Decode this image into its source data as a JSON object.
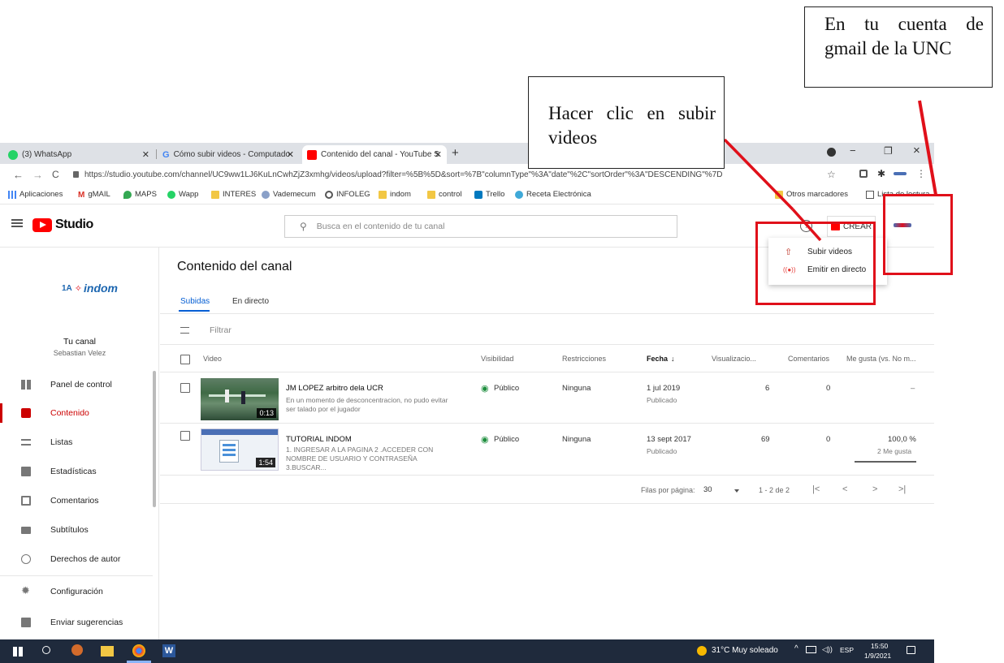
{
  "callouts": {
    "gmail": "En tu cuenta de gmail de la UNC",
    "upload": "Hacer clic en subir videos"
  },
  "browser": {
    "tabs": [
      {
        "label": "(3) WhatsApp",
        "icon": "whatsapp-icon"
      },
      {
        "label": "Cómo subir videos - Computado",
        "icon": "google-icon"
      },
      {
        "label": "Contenido del canal - YouTube S",
        "icon": "youtube-icon"
      }
    ],
    "new_tab": "+",
    "window_min": "−",
    "window_max": "❐",
    "window_close": "×",
    "url": "https://studio.youtube.com/channel/UC9ww1LJ6KuLnCwhZjZ3xmhg/videos/upload?filter=%5B%5D&sort=%7B\"columnType\"%3A\"date\"%2C\"sortOrder\"%3A\"DESCENDING\"%7D",
    "bookmarks": [
      "Aplicaciones",
      "gMAIL",
      "MAPS",
      "Wapp",
      "INTERES",
      "Vademecum",
      "INFOLEG",
      "indom",
      "control",
      "Trello",
      "Receta Electrónica"
    ],
    "other_bookmarks": "Otros marcadores",
    "reading_list": "Lista de lectura"
  },
  "studio": {
    "logo_text": "Studio",
    "search_placeholder": "Busca en el contenido de tu canal",
    "create_label": "CREAR",
    "help_icon": "?",
    "create_menu": [
      "Subir videos",
      "Emitir en directo"
    ]
  },
  "sidebar": {
    "channel_logo_text": "indom",
    "channel_logo_prefix": "1A",
    "channel_title": "Tu canal",
    "channel_owner": "Sebastian Velez",
    "items": [
      {
        "label": "Panel de control",
        "icon": "dashboard-icon"
      },
      {
        "label": "Contenido",
        "icon": "content-icon"
      },
      {
        "label": "Listas",
        "icon": "playlist-icon"
      },
      {
        "label": "Estadísticas",
        "icon": "analytics-icon"
      },
      {
        "label": "Comentarios",
        "icon": "comments-icon"
      },
      {
        "label": "Subtítulos",
        "icon": "subtitles-icon"
      },
      {
        "label": "Derechos de autor",
        "icon": "copyright-icon"
      },
      {
        "label": "Configuración",
        "icon": "gear-icon"
      },
      {
        "label": "Enviar sugerencias",
        "icon": "feedback-icon"
      }
    ],
    "active_index": 1
  },
  "content": {
    "page_title": "Contenido del canal",
    "tabs": [
      "Subidas",
      "En directo"
    ],
    "filter_placeholder": "Filtrar",
    "columns": [
      "Video",
      "Visibilidad",
      "Restricciones",
      "Fecha",
      "Visualizacio...",
      "Comentarios",
      "Me gusta (vs. No m..."
    ],
    "sort_arrow": "↓",
    "rows": [
      {
        "title": "JM LOPEZ arbitro dela UCR",
        "description": "En un momento de desconcentracion, no pudo evitar ser talado por el jugador",
        "duration": "0:13",
        "visibility": "Público",
        "restrictions": "Ninguna",
        "date": "1 jul 2019",
        "status": "Publicado",
        "views": "6",
        "comments": "0",
        "likes": "–",
        "likes_sub": ""
      },
      {
        "title": "TUTORIAL INDOM",
        "description": "1. INGRESAR A LA PAGINA 2 .ACCEDER CON NOMBRE DE USUARIO Y CONTRASEÑA 3.BUSCAR...",
        "duration": "1:54",
        "visibility": "Público",
        "restrictions": "Ninguna",
        "date": "13 sept 2017",
        "status": "Publicado",
        "views": "69",
        "comments": "0",
        "likes": "100,0 %",
        "likes_sub": "2 Me gusta"
      }
    ],
    "pagination": {
      "rows_label": "Filas por página:",
      "rows_value": "30",
      "range": "1 - 2 de 2",
      "first": "|<",
      "prev": "<",
      "next": ">",
      "last": ">|"
    }
  },
  "taskbar": {
    "weather": "31°C Muy soleado",
    "lang": "ESP",
    "time": "15:50",
    "date": "1/9/2021"
  },
  "colors": {
    "yt_red": "#ff0000",
    "annotation_red": "#e0101a",
    "taskbar": "#1f2a3c",
    "public_green": "#1e8e3e"
  }
}
